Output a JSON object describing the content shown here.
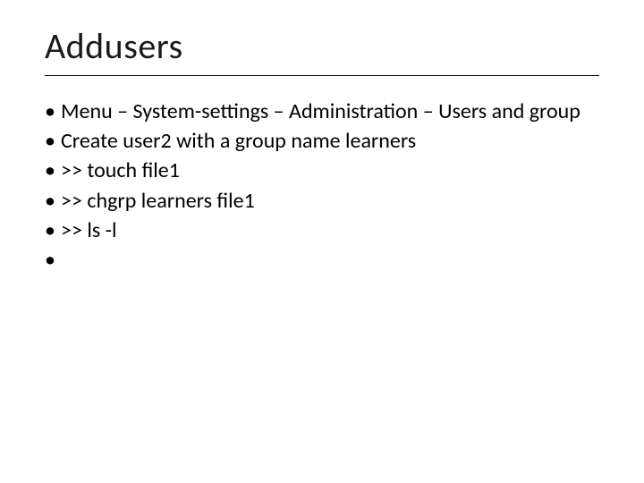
{
  "slide": {
    "title": "Addusers",
    "bullets": [
      "Menu – System-settings – Administration – Users and group",
      "Create user2 with a group name learners",
      ">> touch file1",
      ">> chgrp learners file1",
      ">> ls -l",
      ""
    ]
  }
}
